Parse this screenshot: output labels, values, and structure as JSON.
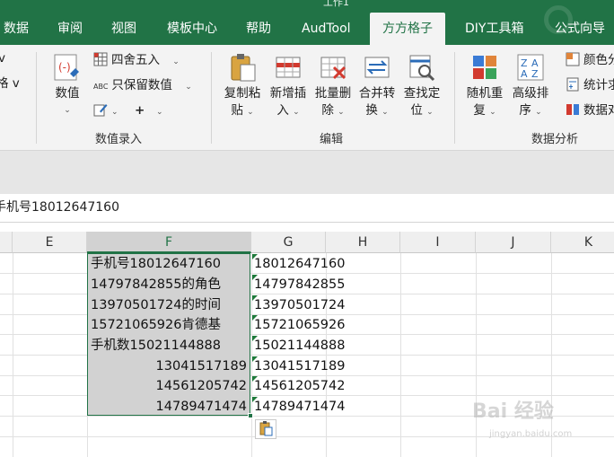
{
  "window": {
    "title_fragment": "工作1"
  },
  "tabs": [
    {
      "label": "数据",
      "active": false
    },
    {
      "label": "审阅",
      "active": false
    },
    {
      "label": "视图",
      "active": false
    },
    {
      "label": "模板中心",
      "active": false
    },
    {
      "label": "帮助",
      "active": false
    },
    {
      "label": "AudTool",
      "active": false
    },
    {
      "label": "方方格子",
      "active": true
    },
    {
      "label": "DIY工具箱",
      "active": false
    },
    {
      "label": "公式向导",
      "active": false
    }
  ],
  "ribbon": {
    "partial_left_1": "v",
    "partial_left_2": "格 v",
    "numeric_group": {
      "label": "数值录入",
      "value_button": "数值",
      "round_button": "四舍五入",
      "keep_value_button": "只保留数值",
      "abc_prefix": "ABC",
      "plus": "+"
    },
    "edit_group": {
      "label": "编辑",
      "buttons": [
        {
          "line1": "复制粘",
          "line2": "贴"
        },
        {
          "line1": "新增插",
          "line2": "入"
        },
        {
          "line1": "批量删",
          "line2": "除"
        },
        {
          "line1": "合并转",
          "line2": "换"
        },
        {
          "line1": "查找定",
          "line2": "位"
        }
      ]
    },
    "analysis_group": {
      "label": "数据分析",
      "buttons": [
        {
          "line1": "随机重",
          "line2": "复"
        },
        {
          "line1": "高级排",
          "line2": "序"
        }
      ],
      "small_buttons": [
        "颜色分",
        "统计求",
        "数据对"
      ]
    },
    "caret": "⌄"
  },
  "formula_bar": {
    "content": "手机号18012647160"
  },
  "columns": [
    "E",
    "F",
    "G",
    "H",
    "I",
    "J",
    "K"
  ],
  "selected_column": "F",
  "column_f": [
    {
      "text": "手机号18012647160",
      "align": "left"
    },
    {
      "text": "14797842855的角色",
      "align": "left"
    },
    {
      "text": "13970501724的时间",
      "align": "left"
    },
    {
      "text": "15721065926肯德基",
      "align": "left"
    },
    {
      "text": "手机数15021144888",
      "align": "left"
    },
    {
      "text": "13041517189",
      "align": "right"
    },
    {
      "text": "14561205742",
      "align": "right"
    },
    {
      "text": "14789471474",
      "align": "right"
    }
  ],
  "column_g": [
    "18012647160",
    "14797842855",
    "13970501724",
    "15721065926",
    "15021144888",
    "13041517189",
    "14561205742",
    "14789471474"
  ],
  "watermark": {
    "text": "Bai 经验",
    "sub": "jingyan.baidu.com"
  },
  "colors": {
    "accent": "#217346",
    "selection": "#d2d2d2",
    "error_triangle": "#1e7a3a"
  }
}
